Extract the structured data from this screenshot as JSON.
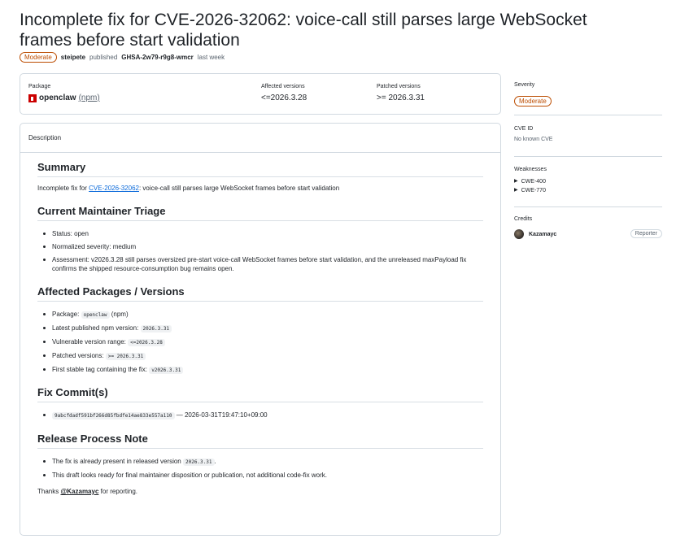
{
  "header": {
    "title": "Incomplete fix for CVE-2026-32062: voice-call still parses large WebSocket frames before start validation",
    "severity_badge": "Moderate",
    "author": "steipete",
    "published_text": "published",
    "advisory_id": "GHSA-2w79-r9g8-wmcr",
    "when": "last week"
  },
  "package_box": {
    "package_label": "Package",
    "package_name": "openclaw",
    "ecosystem": "(npm)",
    "affected_label": "Affected versions",
    "affected_value": "<=2026.3.28",
    "patched_label": "Patched versions",
    "patched_value": ">= 2026.3.31"
  },
  "description": {
    "header": "Description",
    "summary_heading": "Summary",
    "summary_prefix": "Incomplete fix for",
    "summary_link": "CVE-2026-32062",
    "summary_suffix": ": voice-call still parses large WebSocket frames before start validation",
    "triage_heading": "Current Maintainer Triage",
    "triage_items": [
      "Status: open",
      "Normalized severity: medium",
      "Assessment: v2026.3.28 still parses oversized pre-start voice-call WebSocket frames before start validation, and the unreleased maxPayload fix confirms the shipped resource-consumption bug remains open."
    ],
    "affected_heading": "Affected Packages / Versions",
    "affected_items": [
      {
        "text": "Package:",
        "code": "openclaw",
        "suffix": " (npm)"
      },
      {
        "text": "Latest published npm version:",
        "code": "2026.3.31",
        "suffix": ""
      },
      {
        "text": "Vulnerable version range:",
        "code": "<=2026.3.28",
        "suffix": ""
      },
      {
        "text": "Patched versions:",
        "code": ">= 2026.3.31",
        "suffix": ""
      },
      {
        "text": "First stable tag containing the fix:",
        "code": "v2026.3.31",
        "suffix": ""
      }
    ],
    "fix_heading": "Fix Commit(s)",
    "fix_commit": "9abcfdadf591bf266d85fbdfe14ae833e557a110",
    "fix_commit_suffix": " — 2026-03-31T19:47:10+09:00",
    "release_heading": "Release Process Note",
    "release_item1_prefix": "The fix is already present in released version",
    "release_item1_code": "2026.3.31",
    "release_item1_suffix": ".",
    "release_item2": "This draft looks ready for final maintainer disposition or publication, not additional code-fix work.",
    "thanks_prefix": "Thanks",
    "thanks_user": "@Kazamayc",
    "thanks_suffix": "for reporting."
  },
  "sidebar": {
    "severity_label": "Severity",
    "severity_value": "Moderate",
    "cve_label": "CVE ID",
    "cve_value": "No known CVE",
    "weak_label": "Weaknesses",
    "weaknesses": [
      "CWE-400",
      "CWE-770"
    ],
    "credits_label": "Credits",
    "credit_user": "Kazamayc",
    "credit_role": "Reporter"
  },
  "colors": {
    "moderate": "#bc4c00",
    "link": "#0969da",
    "border": "#d1d9e0",
    "npm": "#cb0000"
  }
}
